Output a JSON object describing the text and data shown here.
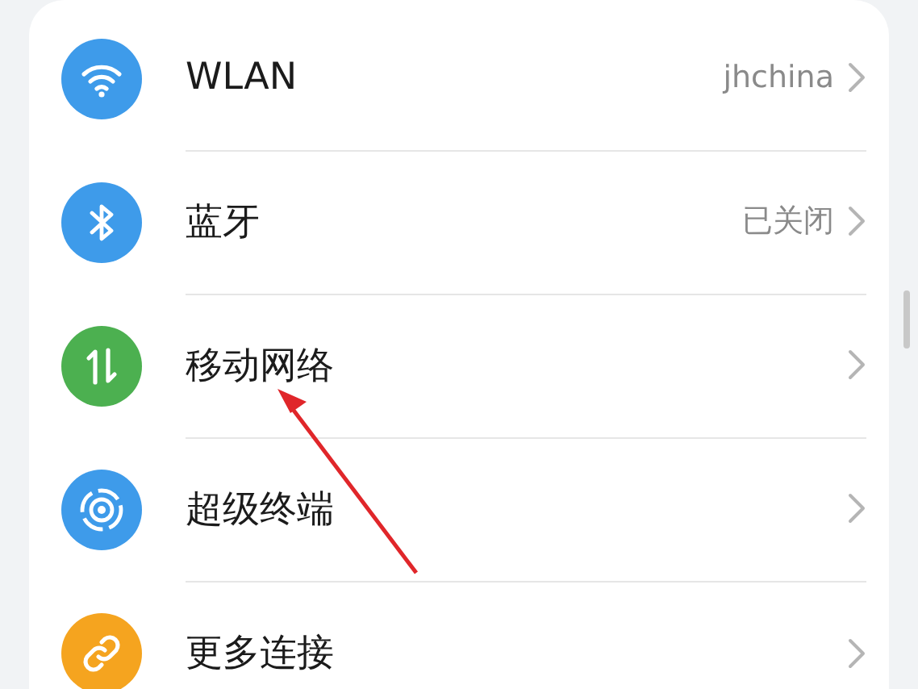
{
  "settings_list": [
    {
      "label": "WLAN",
      "value": "jhchina",
      "color": "#3e9bea"
    },
    {
      "label": "蓝牙",
      "value": "已关闭",
      "color": "#3e9bea"
    },
    {
      "label": "移动网络",
      "color": "#4cb050"
    },
    {
      "label": "超级终端",
      "color": "#3e9bea"
    },
    {
      "label": "更多连接",
      "color": "#f5a41f"
    }
  ]
}
